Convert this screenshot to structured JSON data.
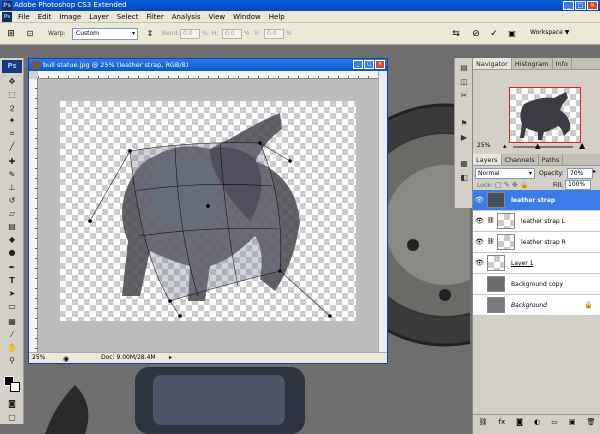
{
  "app": {
    "title": "Adobe Photoshop CS3 Extended",
    "logo": "Ps"
  },
  "menu": [
    "File",
    "Edit",
    "Image",
    "Layer",
    "Select",
    "Filter",
    "Analysis",
    "View",
    "Window",
    "Help"
  ],
  "options": {
    "warp_label": "Warp:",
    "warp_value": "Custom",
    "bend_label": "Bend:",
    "bend_value": "0.0",
    "h_label": "H:",
    "h_value": "0.0",
    "v_label": "V:",
    "v_value": "0.0",
    "pct": "%",
    "workspace": "Workspace ▼"
  },
  "document": {
    "title": "bull statue.jpg @ 25% (leather strap, RGB/8)",
    "zoom": "25%",
    "doc_info": "Doc: 9.00M/28.4M"
  },
  "navigator": {
    "tabs": [
      "Navigator",
      "Histogram",
      "Info"
    ],
    "zoom": "25%"
  },
  "layers_panel": {
    "tabs": [
      "Layers",
      "Channels",
      "Paths"
    ],
    "blend_mode": "Normal",
    "opacity_label": "Opacity:",
    "opacity_value": "70%",
    "lock_label": "Lock:",
    "fill_label": "Fill:",
    "fill_value": "100%",
    "layers": [
      {
        "name": "leather strap",
        "selected": true
      },
      {
        "name": "leather strap L",
        "selected": false
      },
      {
        "name": "leather strap R",
        "selected": false
      },
      {
        "name": "Layer 1",
        "selected": false
      },
      {
        "name": "Background copy",
        "selected": false
      },
      {
        "name": "Background",
        "selected": false
      }
    ]
  },
  "icons": [
    "eye-icon",
    "lock-icon",
    "link-icon",
    "move-icon",
    "lasso-icon",
    "crop-icon",
    "brush-icon",
    "eraser-icon",
    "text-icon",
    "zoom-icon",
    "hand-icon"
  ],
  "colors": {
    "accent": "#3b7de8",
    "titlebar": "#0846b8"
  }
}
